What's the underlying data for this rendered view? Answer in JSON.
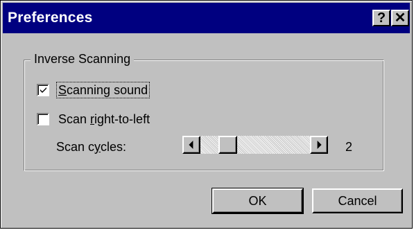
{
  "window": {
    "title": "Preferences",
    "help_button": "?",
    "close_button": "✕"
  },
  "group": {
    "label": "Inverse Scanning"
  },
  "options": {
    "scanning_sound": {
      "mnemonic": "S",
      "rest": "canning sound",
      "checked": true
    },
    "scan_right_to_left": {
      "before": "Scan ",
      "mnemonic": "r",
      "rest": "ight-to-left",
      "checked": false
    }
  },
  "scan_cycles": {
    "label_before": "Scan c",
    "label_mnemonic": "y",
    "label_after": "cles:",
    "value": "2"
  },
  "buttons": {
    "ok": "OK",
    "cancel": "Cancel"
  },
  "icons": {
    "help": "question-mark-icon",
    "close": "close-icon",
    "check": "checkmark-icon",
    "scroll_left": "left-arrow-icon",
    "scroll_right": "right-arrow-icon"
  }
}
